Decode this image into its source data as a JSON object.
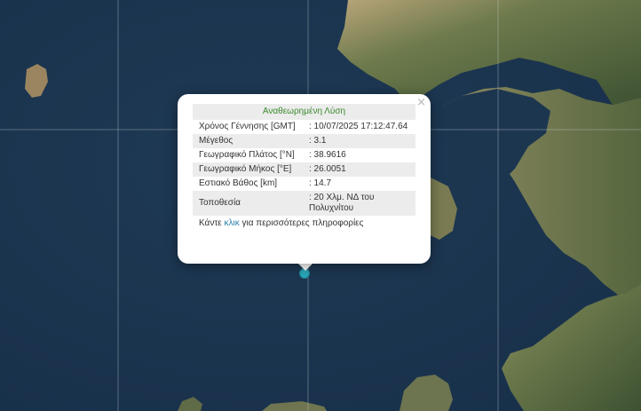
{
  "popup": {
    "title": "Αναθεωρημένη Λύση",
    "close": "×",
    "rows": [
      {
        "label": "Χρόνος Γέννησης [GMT]",
        "value": ": 10/07/2025 17:12:47.64"
      },
      {
        "label": "Μέγεθος",
        "value": ": 3.1"
      },
      {
        "label": "Γεωγραφικό Πλάτος [°N]",
        "value": ": 38.9616"
      },
      {
        "label": "Γεωγραφικό Μήκος [°E]",
        "value": ": 26.0051"
      },
      {
        "label": "Εστιακό Βάθος [km]",
        "value": ": 14.7"
      },
      {
        "label": "Τοποθεσία",
        "value": ": 20 Χλμ. ΝΔ του Πολυχνίτου"
      }
    ],
    "more_prefix": "Κάντε ",
    "more_link": "κλικ",
    "more_suffix": " για περισσότερες πληροφορίες"
  },
  "colors": {
    "sea": "#1d3650",
    "land": "#5e6b45",
    "highlight": "#2a7fa9",
    "title_green": "#3a8a2c",
    "marker": "#2aa6b8"
  },
  "icons": [
    "close-icon",
    "earthquake-marker"
  ]
}
